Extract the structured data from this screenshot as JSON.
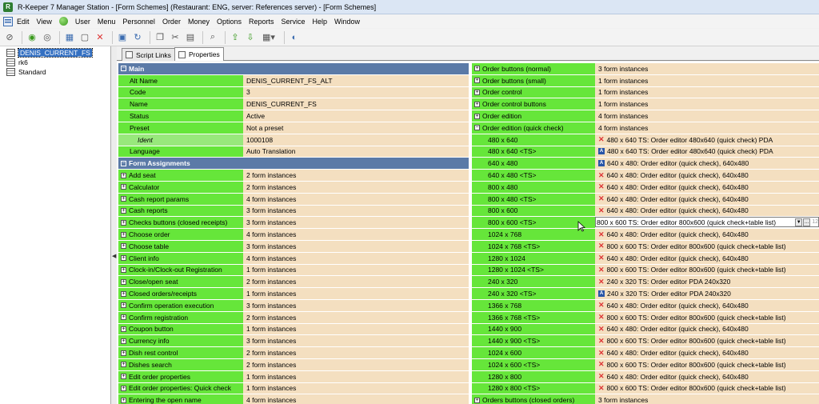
{
  "window": {
    "title": "R-Keeper 7 Manager Station - [Form Schemes] (Restaurant: ENG, server: References server) - [Form Schemes]"
  },
  "menu": [
    "Edit",
    "View",
    "User",
    "Menu",
    "Personnel",
    "Order",
    "Money",
    "Options",
    "Reports",
    "Service",
    "Help",
    "Window"
  ],
  "tree": {
    "items": [
      "DENIS_CURRENT_FS",
      "rk6",
      "Standard"
    ],
    "selected": 0
  },
  "tabs": [
    "Script Links",
    "Properties"
  ],
  "left": [
    {
      "type": "cat",
      "label": "Main"
    },
    {
      "type": "prop",
      "label": "Alt Name",
      "value": "DENIS_CURRENT_FS_ALT"
    },
    {
      "type": "prop",
      "label": "Code",
      "value": "3"
    },
    {
      "type": "prop",
      "label": "Name",
      "value": "DENIS_CURRENT_FS"
    },
    {
      "type": "prop",
      "label": "Status",
      "value": "Active"
    },
    {
      "type": "prop",
      "label": "Preset",
      "value": "Not a preset"
    },
    {
      "type": "prop",
      "label": "Ident",
      "value": "1000108",
      "italic": true
    },
    {
      "type": "prop",
      "label": "Language",
      "value": "Auto Translation"
    },
    {
      "type": "cat",
      "label": "Form Assignments"
    },
    {
      "type": "exp",
      "label": "Add seat",
      "value": "2 form instances"
    },
    {
      "type": "exp",
      "label": "Calculator",
      "value": "2 form instances"
    },
    {
      "type": "exp",
      "label": "Cash report params",
      "value": "4 form instances"
    },
    {
      "type": "exp",
      "label": "Cash reports",
      "value": "3 form instances"
    },
    {
      "type": "exp",
      "label": "Checks buttons (closed receipts)",
      "value": "3 form instances"
    },
    {
      "type": "exp",
      "label": "Choose order",
      "value": "4 form instances"
    },
    {
      "type": "exp",
      "label": "Choose table",
      "value": "3 form instances"
    },
    {
      "type": "exp",
      "label": "Client info",
      "value": "4 form instances"
    },
    {
      "type": "exp",
      "label": "Clock-in/Clock-out Registration",
      "value": "1 form instances"
    },
    {
      "type": "exp",
      "label": "Close/open seat",
      "value": "2 form instances"
    },
    {
      "type": "exp",
      "label": "Closed orders/receipts",
      "value": "1 form instances"
    },
    {
      "type": "exp",
      "label": "Confirm operation execution",
      "value": "3 form instances"
    },
    {
      "type": "exp",
      "label": "Confirm registration",
      "value": "2 form instances"
    },
    {
      "type": "exp",
      "label": "Coupon button",
      "value": "1 form instances"
    },
    {
      "type": "exp",
      "label": "Currency info",
      "value": "3 form instances"
    },
    {
      "type": "exp",
      "label": "Dish rest control",
      "value": "2 form instances"
    },
    {
      "type": "exp",
      "label": "Dishes search",
      "value": "2 form instances"
    },
    {
      "type": "exp",
      "label": "Edit order properties",
      "value": "1 form instances"
    },
    {
      "type": "exp",
      "label": "Edit order properties: Quick check",
      "value": "1 form instances"
    },
    {
      "type": "exp",
      "label": "Entering the open name",
      "value": "4 form instances"
    }
  ],
  "right": [
    {
      "type": "exp",
      "label": "Order buttons (normal)",
      "value": "3 form instances"
    },
    {
      "type": "exp",
      "label": "Order buttons (small)",
      "value": "1 form instances"
    },
    {
      "type": "exp",
      "label": "Order control",
      "value": "1 form instances"
    },
    {
      "type": "exp",
      "label": "Order control buttons",
      "value": "1 form instances"
    },
    {
      "type": "exp",
      "label": "Order edition",
      "value": "4 form instances"
    },
    {
      "type": "open",
      "label": "Order edition (quick check)",
      "value": "4 form instances"
    },
    {
      "type": "sub",
      "label": "480 x 640",
      "value": "480 x 640 TS: Order editor 480x640 (quick check) PDA",
      "icon": "x"
    },
    {
      "type": "sub",
      "label": "480 x 640 <TS>",
      "value": "480 x 640 TS: Order editor 480x640 (quick check) PDA",
      "icon": "a"
    },
    {
      "type": "sub",
      "label": "640 x 480",
      "value": "640 x 480: Order editor (quick check), 640x480",
      "icon": "a"
    },
    {
      "type": "sub",
      "label": "640 x 480 <TS>",
      "value": "640 x 480: Order editor (quick check), 640x480",
      "icon": "x"
    },
    {
      "type": "sub",
      "label": "800 x 480",
      "value": "640 x 480: Order editor (quick check), 640x480",
      "icon": "x"
    },
    {
      "type": "sub",
      "label": "800 x 480 <TS>",
      "value": "640 x 480: Order editor (quick check), 640x480",
      "icon": "x"
    },
    {
      "type": "sub",
      "label": "800 x 600",
      "value": "640 x 480: Order editor (quick check), 640x480",
      "icon": "x"
    },
    {
      "type": "edit",
      "label": "800 x 600 <TS>",
      "value": "800 x 600 TS: Order editor 800x600 (quick check+table list)",
      "icon": "none",
      "extra": "12"
    },
    {
      "type": "sub",
      "label": "1024 x 768",
      "value": "640 x 480: Order editor (quick check), 640x480",
      "icon": "x"
    },
    {
      "type": "sub",
      "label": "1024 x 768 <TS>",
      "value": "800 x 600 TS: Order editor 800x600 (quick check+table list)",
      "icon": "x"
    },
    {
      "type": "sub",
      "label": "1280 x 1024",
      "value": "640 x 480: Order editor (quick check), 640x480",
      "icon": "x"
    },
    {
      "type": "sub",
      "label": "1280 x 1024 <TS>",
      "value": "800 x 600 TS: Order editor 800x600 (quick check+table list)",
      "icon": "x"
    },
    {
      "type": "sub",
      "label": "240 x 320",
      "value": "240 x 320 TS: Order editor PDA 240x320",
      "icon": "x"
    },
    {
      "type": "sub",
      "label": "240 x 320 <TS>",
      "value": "240 x 320 TS: Order editor PDA 240x320",
      "icon": "a"
    },
    {
      "type": "sub",
      "label": "1366 x 768",
      "value": "640 x 480: Order editor (quick check), 640x480",
      "icon": "x"
    },
    {
      "type": "sub",
      "label": "1366 x 768 <TS>",
      "value": "800 x 600 TS: Order editor 800x600 (quick check+table list)",
      "icon": "x"
    },
    {
      "type": "sub",
      "label": "1440 x 900",
      "value": "640 x 480: Order editor (quick check), 640x480",
      "icon": "x"
    },
    {
      "type": "sub",
      "label": "1440 x 900 <TS>",
      "value": "800 x 600 TS: Order editor 800x600 (quick check+table list)",
      "icon": "x"
    },
    {
      "type": "sub",
      "label": "1024 x 600",
      "value": "640 x 480: Order editor (quick check), 640x480",
      "icon": "x"
    },
    {
      "type": "sub",
      "label": "1024 x 600 <TS>",
      "value": "800 x 600 TS: Order editor 800x600 (quick check+table list)",
      "icon": "x"
    },
    {
      "type": "sub",
      "label": "1280 x 800",
      "value": "640 x 480: Order editor (quick check), 640x480",
      "icon": "x"
    },
    {
      "type": "sub",
      "label": "1280 x 800 <TS>",
      "value": "800 x 600 TS: Order editor 800x600 (quick check+table list)",
      "icon": "x"
    },
    {
      "type": "exp",
      "label": "Orders buttons (closed orders)",
      "value": "3 form instances"
    }
  ],
  "colors": {
    "green": "#66e63a",
    "pale_green": "#98e87c",
    "value_bg": "#f4dfc0",
    "category": "#5b7aa7"
  }
}
